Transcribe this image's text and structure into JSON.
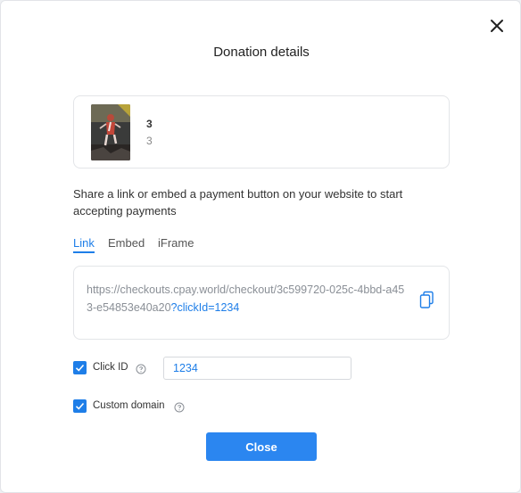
{
  "dialog": {
    "title": "Donation details",
    "close_icon": "close-icon"
  },
  "product": {
    "name": "3",
    "description": "3",
    "image_icon": "product-thumbnail"
  },
  "description": "Share a link or embed a payment button on your website to start accepting payments",
  "tabs": [
    {
      "label": "Link",
      "active": true
    },
    {
      "label": "Embed",
      "active": false
    },
    {
      "label": "iFrame",
      "active": false
    }
  ],
  "url": {
    "base": "https://checkouts.cpay.world/checkout/3c599720-025c-4bbd-a453-e54853e40a20",
    "click_param": "?clickId=1234",
    "copy_icon": "copy-icon"
  },
  "options": {
    "click_id": {
      "label": "Click ID",
      "checked": true,
      "value": "1234"
    },
    "custom_domain": {
      "label": "Custom domain",
      "checked": true
    }
  },
  "actions": {
    "close_label": "Close"
  },
  "colors": {
    "accent": "#1e7ee8",
    "button": "#2b86f0",
    "muted_text": "#8a8f96"
  }
}
